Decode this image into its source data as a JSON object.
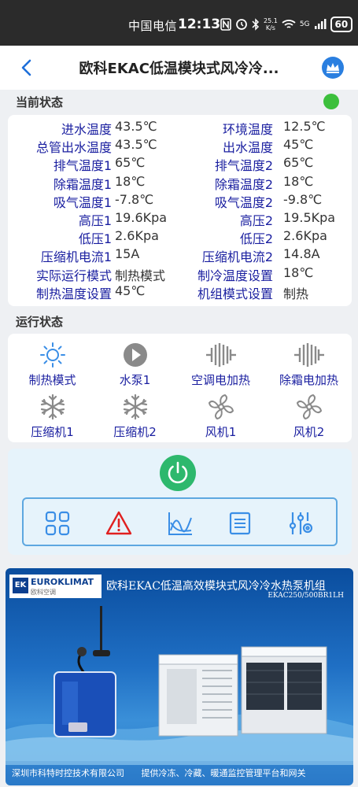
{
  "statusbar": {
    "carrier": "中国电信",
    "time": "12:13",
    "speed_top": "25.1",
    "speed_bottom": "K/s",
    "network": "5G",
    "battery": "60"
  },
  "header": {
    "title": "欧科EKAC低温模块式风冷冷..."
  },
  "current_status": {
    "label": "当前状态",
    "rows": [
      {
        "l1": "进水温度",
        "v1": "43.5℃",
        "l2": "环境温度",
        "v2": "12.5℃"
      },
      {
        "l1": "总管出水温度",
        "v1": "43.5℃",
        "l2": "出水温度",
        "v2": "45℃"
      },
      {
        "l1": "排气温度1",
        "v1": "65℃",
        "l2": "排气温度2",
        "v2": "65℃"
      },
      {
        "l1": "除霜温度1",
        "v1": "18℃",
        "l2": "除霜温度2",
        "v2": "18℃"
      },
      {
        "l1": "吸气温度1",
        "v1": "-7.8℃",
        "l2": "吸气温度2",
        "v2": "-9.8℃"
      },
      {
        "l1": "高压1",
        "v1": "19.6Kpa",
        "l2": "高压2",
        "v2": "19.5Kpa"
      },
      {
        "l1": "低压1",
        "v1": "2.6Kpa",
        "l2": "低压2",
        "v2": "2.6Kpa"
      },
      {
        "l1": "压缩机电流1",
        "v1": "15A",
        "l2": "压缩机电流2",
        "v2": "14.8A"
      },
      {
        "l1": "实际运行模式",
        "v1": "制热模式",
        "l2": "制冷温度设置",
        "v2": "18℃"
      },
      {
        "l1": "制热温度设置",
        "v1": "45℃",
        "l2": "机组模式设置",
        "v2": "制热"
      }
    ]
  },
  "run_status": {
    "label": "运行状态",
    "items": [
      {
        "label": "制热模式",
        "icon": "sun-icon"
      },
      {
        "label": "水泵1",
        "icon": "pump-icon"
      },
      {
        "label": "空调电加热",
        "icon": "heater-icon"
      },
      {
        "label": "除霜电加热",
        "icon": "heater-icon"
      },
      {
        "label": "压缩机1",
        "icon": "snowflake-icon"
      },
      {
        "label": "压缩机2",
        "icon": "snowflake-icon"
      },
      {
        "label": "风机1",
        "icon": "fan-icon"
      },
      {
        "label": "风机2",
        "icon": "fan-icon"
      }
    ]
  },
  "controls": {
    "tools": [
      "grid-icon",
      "alarm-icon",
      "chart-icon",
      "list-icon",
      "settings-icon"
    ]
  },
  "banner": {
    "brand_en": "EUROKLIMAT",
    "brand_cn": "欧科空调",
    "brand_mark": "EK",
    "title": "欧科EKAC低温高效模块式风冷冷水热泵机组",
    "model": "EKAC250/500BR1LH",
    "footer_left": "深圳市科特时控技术有限公司",
    "footer_right": "提供冷冻、冷藏、暖通监控管理平台和网关"
  },
  "colors": {
    "label_blue": "#1a1fa0",
    "icon_blue": "#3a8ee6",
    "icon_gray": "#8a8a8a",
    "running_green": "#3cbf3c",
    "power_green": "#2db86d",
    "alarm_red": "#e02020"
  }
}
